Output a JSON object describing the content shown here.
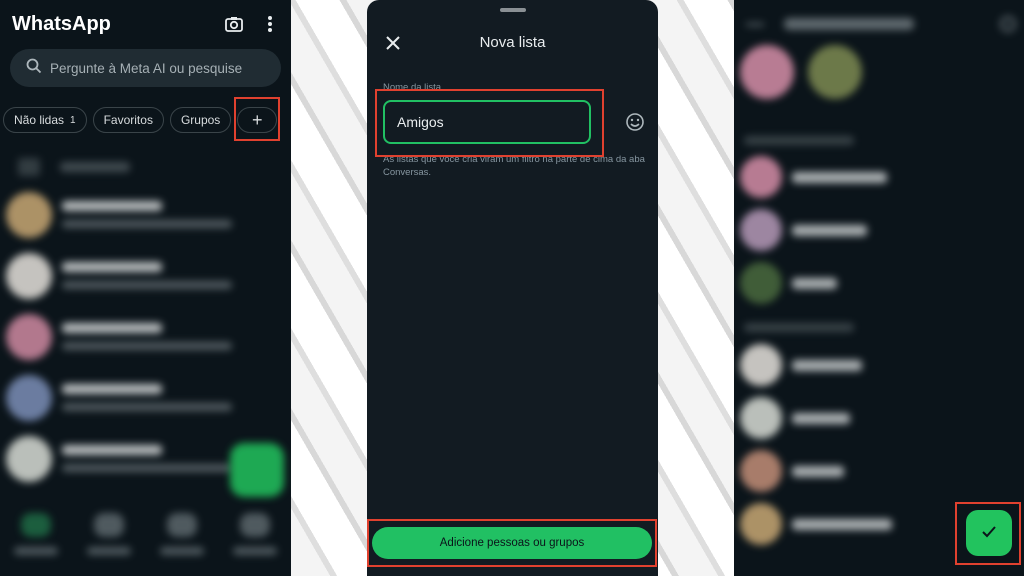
{
  "left_panel": {
    "app_title": "WhatsApp",
    "search_placeholder": "Pergunte à Meta AI ou pesquise",
    "chips": [
      {
        "label": "Não lidas",
        "count": "1"
      },
      {
        "label": "Favoritos"
      },
      {
        "label": "Grupos"
      }
    ],
    "add_chip_symbol": "+",
    "icons": [
      "camera-icon",
      "more-vert-icon",
      "search-icon"
    ]
  },
  "sheet": {
    "title": "Nova lista",
    "field_label": "Nome da lista",
    "field_value": "Amigos",
    "helper_text": "As listas que você cria viram um filtro na parte de cima da aba Conversas.",
    "primary_button": "Adicione pessoas ou grupos",
    "icons": [
      "close-icon",
      "emoji-icon"
    ]
  },
  "right_panel": {
    "confirm_icon": "check-icon"
  },
  "colors": {
    "accent_green": "#21c063",
    "highlight_red": "#e0412f",
    "dark_bg": "#0b141a",
    "sheet_bg": "#121b22"
  }
}
